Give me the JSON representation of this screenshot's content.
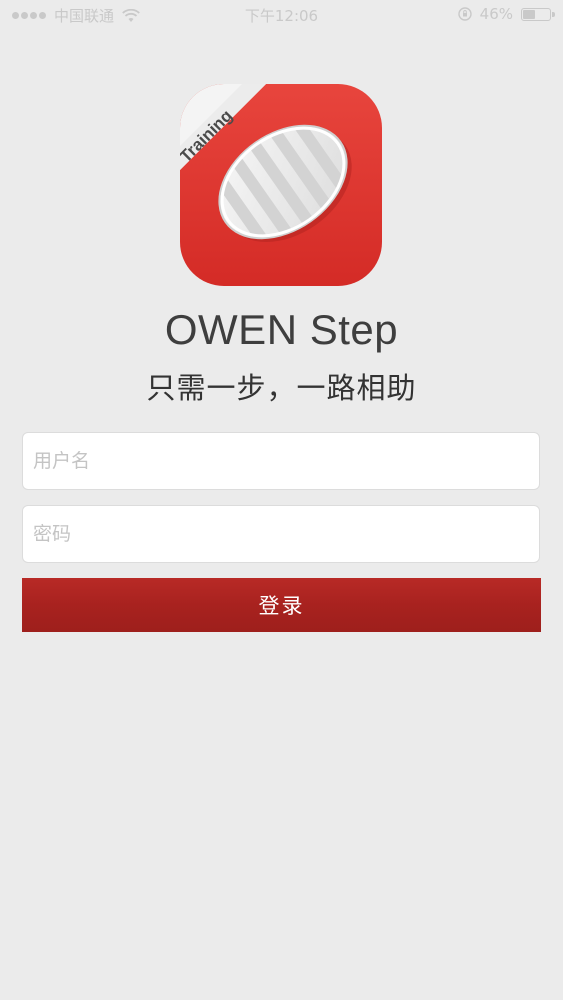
{
  "status_bar": {
    "carrier": "中国联通",
    "time": "下午12:06",
    "battery_percent": "46%",
    "battery_level": 0.46
  },
  "app": {
    "icon_badge": "Training",
    "title": "OWEN Step",
    "tagline": "只需一步，一路相助"
  },
  "login_form": {
    "username_placeholder": "用户名",
    "username_value": "",
    "password_placeholder": "密码",
    "password_value": "",
    "login_label": "登录"
  },
  "colors": {
    "accent": "#a8221f",
    "background": "#ebebeb",
    "icon_red": "#e23a33"
  },
  "icons": {
    "signal": "signal-dots-icon",
    "wifi": "wifi-icon",
    "orientation_lock": "orientation-lock-icon",
    "battery": "battery-icon",
    "app": "insole-app-icon"
  }
}
